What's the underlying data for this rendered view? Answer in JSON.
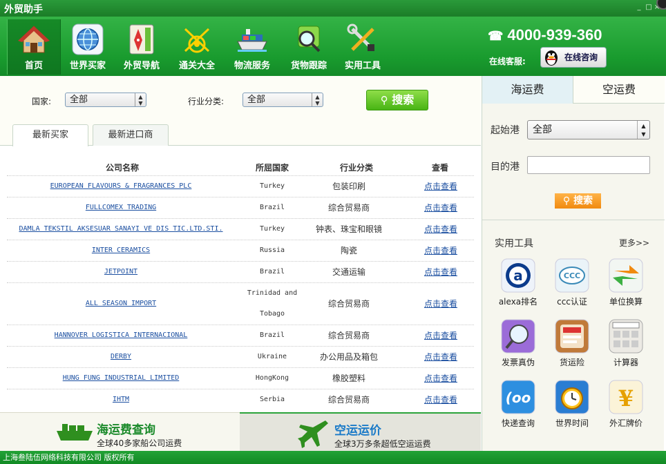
{
  "window": {
    "title": "外贸助手"
  },
  "nav": [
    {
      "label": "首页",
      "icon": "house-icon"
    },
    {
      "label": "世界买家",
      "icon": "globe-icon"
    },
    {
      "label": "外贸导航",
      "icon": "compass-icon"
    },
    {
      "label": "通关大全",
      "icon": "customs-icon"
    },
    {
      "label": "物流服务",
      "icon": "ship-icon"
    },
    {
      "label": "货物跟踪",
      "icon": "tracking-icon"
    },
    {
      "label": "实用工具",
      "icon": "tools-icon"
    }
  ],
  "contact": {
    "hotline": "4000-939-360",
    "online_label": "在线客服:",
    "consult_label": "在线咨询"
  },
  "filters": {
    "country_label": "国家:",
    "country_value": "全部",
    "industry_label": "行业分类:",
    "industry_value": "全部",
    "search_label": "搜索"
  },
  "tabs": [
    {
      "label": "最新买家",
      "active": true
    },
    {
      "label": "最新进口商",
      "active": false
    }
  ],
  "table": {
    "headers": [
      "公司名称",
      "所屈国家",
      "行业分类",
      "查看"
    ],
    "rows": [
      {
        "company": "EUROPEAN FLAVOURS & FRAGRANCES PLC",
        "country": "Turkey",
        "industry": "包装印刷",
        "view": "点击查看"
      },
      {
        "company": "FULLCOMEX TRADING",
        "country": "Brazil",
        "industry": "综合贸易商",
        "view": "点击查看"
      },
      {
        "company": "DAMLA TEKSTIL AKSESUAR SANAYI VE DIS TIC.LTD.STI.",
        "country": "Turkey",
        "industry": "钟表、珠宝和眼镜",
        "view": "点击查看"
      },
      {
        "company": "INTER CERAMICS",
        "country": "Russia",
        "industry": "陶瓷",
        "view": "点击查看"
      },
      {
        "company": "JETPOINT",
        "country": "Brazil",
        "industry": "交通运输",
        "view": "点击查看"
      },
      {
        "company": "ALL SEASON IMPORT",
        "country_line1": "Trinidad and",
        "country_line2": "Tobago",
        "industry": "综合贸易商",
        "view": "点击查看"
      },
      {
        "company": "HANNOVER LOGISTICA INTERNACIONAL",
        "country": "Brazil",
        "industry": "综合贸易商",
        "view": "点击查看"
      },
      {
        "company": "DERBY",
        "country": "Ukraine",
        "industry": "办公用品及箱包",
        "view": "点击查看"
      },
      {
        "company": "HUNG FUNG INDUSTRIAL LIMITED",
        "country": "HongKong",
        "industry": "橡胶塑料",
        "view": "点击查看"
      },
      {
        "company": "IHTM",
        "country": "Serbia",
        "industry": "综合贸易商",
        "view": "点击查看"
      }
    ]
  },
  "promo": {
    "sea_title": "海运费查询",
    "sea_sub": "全球40多家船公司运费",
    "air_title": "空运运价",
    "air_sub": "全球3万多条超低空运运费"
  },
  "freight": {
    "tab_sea": "海运费",
    "tab_air": "空运费",
    "origin_label": "起始港",
    "origin_value": "全部",
    "dest_label": "目的港",
    "dest_value": "",
    "search_label": "搜索"
  },
  "tools": {
    "heading": "实用工具",
    "more": "更多>>",
    "items": [
      {
        "label": "alexa排名",
        "icon": "alexa-icon"
      },
      {
        "label": "ccc认证",
        "icon": "ccc-icon"
      },
      {
        "label": "单位换算",
        "icon": "unit-convert-icon"
      },
      {
        "label": "发票真伪",
        "icon": "invoice-magnifier-icon"
      },
      {
        "label": "货运险",
        "icon": "cargo-insurance-icon"
      },
      {
        "label": "计算器",
        "icon": "calculator-icon"
      },
      {
        "label": "快递查询",
        "icon": "express-icon"
      },
      {
        "label": "世界时间",
        "icon": "alarm-clock-icon"
      },
      {
        "label": "外汇牌价",
        "icon": "currency-icon"
      }
    ]
  },
  "footer": {
    "copyright": "上海叁陆伍网络科技有限公司 版权所有"
  },
  "colors": {
    "brand_green": "#1f9d33",
    "link_blue": "#1a4ea0",
    "accent_orange": "#f08a10"
  }
}
